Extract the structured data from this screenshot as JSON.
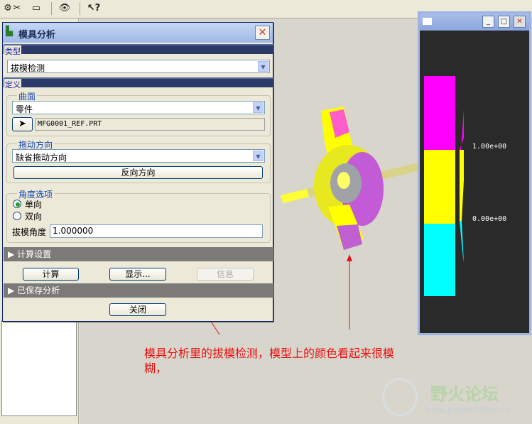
{
  "dialog": {
    "title": "模具分析",
    "close_glyph": "✕",
    "type_section_label": "类型",
    "analysis_type": "拔模检测",
    "definition_section_label": "定义",
    "surface_group_label": "曲面",
    "surface_type": "零件",
    "part_name": "MFG0001_REF.PRT",
    "direction_group_label": "拖动方向",
    "direction_value": "缺省拖动方向",
    "reverse_button": "反向方向",
    "angle_group_label": "角度选项",
    "option_single": "单向",
    "option_double": "双向",
    "draft_angle_label": "拔模角度",
    "draft_angle_value": "1.000000",
    "calc_settings_label": "计算设置",
    "compute_button": "计算",
    "display_button": "显示...",
    "info_button": "信息",
    "saved_analysis_label": "已保存分析",
    "close_button": "关闭"
  },
  "scale_window": {
    "upper_value": "1.00e+00",
    "lower_value": "0.00e+00",
    "band_colors": [
      "#ff00ff",
      "#ffff00",
      "#00ffff"
    ]
  },
  "annotation": {
    "line1": "模具分析里的拔模检测，模型上的颜色看起来很模",
    "line2": "糊，"
  },
  "watermark": {
    "name": "野火论坛",
    "url": "www.proewildfire.cn"
  },
  "toolbar_icons": [
    "tool-icon-1",
    "tool-icon-2",
    "tool-icon-3",
    "hide-icon",
    "help-cursor-icon"
  ]
}
